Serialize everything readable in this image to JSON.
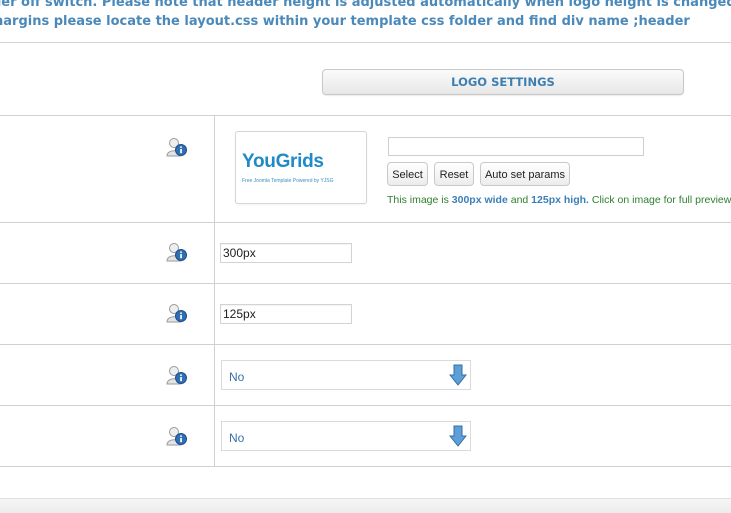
{
  "notice": {
    "line1": "der off switch. Please note that header height is adjusted automatically when logo height is changed. Header block",
    "line2": "nargins please locate the layout.css within your template css folder and find div name ;header"
  },
  "section_button_label": "LOGO SETTINGS",
  "logo": {
    "brand": "YouGrids",
    "tagline": "Free Joomla Template Powered by YJSG",
    "path_value": "",
    "buttons": {
      "select": "Select",
      "reset": "Reset",
      "auto": "Auto set params"
    },
    "hint": {
      "prefix": "This image is ",
      "width": "300px wide",
      "middle": " and ",
      "height": "125px high.",
      "suffix": " Click on image for full preview"
    }
  },
  "fields": {
    "width_value": "300px",
    "height_value": "125px",
    "select1_value": "No",
    "select2_value": "No"
  },
  "icons": {
    "help": "user-info-icon",
    "dropdown": "down-arrow-icon"
  },
  "colors": {
    "accent": "#4a89b9",
    "hint_green": "#2f7f2f",
    "arrow_blue": "#4f93cc"
  }
}
